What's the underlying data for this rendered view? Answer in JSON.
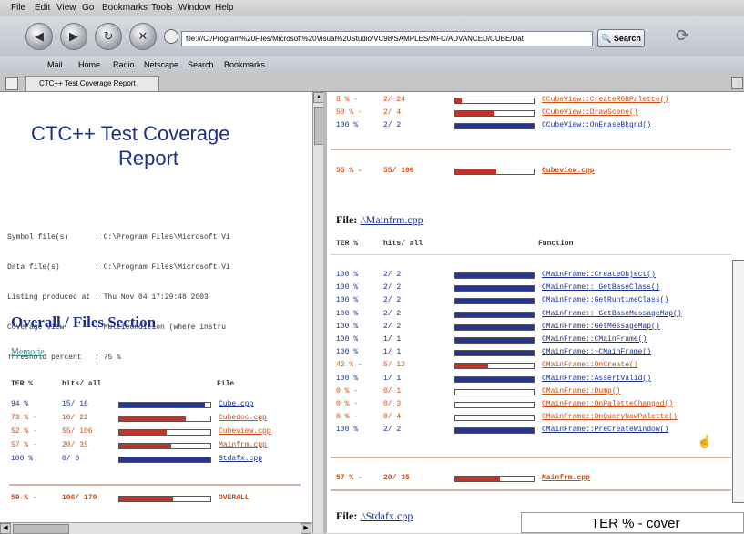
{
  "menu": [
    "File",
    "Edit",
    "View",
    "Go",
    "Bookmarks",
    "Tools",
    "Window",
    "Help"
  ],
  "url": "file:///C:/Program%20Files/Microsoft%20Visual%20Studio/VC98/SAMPLES/MFC/ADVANCED/CUBE/Dat",
  "search_label": "Search",
  "bookmarks": [
    "Mail",
    "Home",
    "Radio",
    "Netscape",
    "Search",
    "Bookmarks"
  ],
  "tab_title": "CTC++ Test Coverage Report",
  "left": {
    "title_line1": "CTC++ Test Coverage",
    "title_line2": "Report",
    "info": [
      {
        "key": "Symbol file(s)     ",
        "val": ": C:\\Program Files\\Microsoft Vi"
      },
      {
        "key": "Data file(s)       ",
        "val": ": C:\\Program Files\\Microsoft Vi"
      },
      {
        "key": "Listing produced at",
        "val": ": Thu Nov 04 17:29:48 2003"
      },
      {
        "key": "Coverage view      ",
        "val": ": Multicondition (where instru"
      },
      {
        "key": "Threshold percent  ",
        "val": ": 75 %"
      }
    ],
    "section_title": "Overall / Files Section",
    "memorie_link": "Memorie",
    "col_ter": "TER %",
    "col_hits": "hits/ all",
    "col_file": "File",
    "files": [
      {
        "ter": "94 %",
        "hits": "15/ 16",
        "file": "Cube.cpp",
        "pct": 94,
        "below": false
      },
      {
        "ter": "73 % -",
        "hits": "16/ 22",
        "file": "Cubedoc.cpp",
        "pct": 73,
        "below": true
      },
      {
        "ter": "52 % -",
        "hits": "55/ 106",
        "file": "Cubeview.cpp",
        "pct": 52,
        "below": true
      },
      {
        "ter": "57 % -",
        "hits": "20/ 35",
        "file": "Mainfrm.cpp",
        "pct": 57,
        "below": true
      },
      {
        "ter": "100 %",
        "hits": "0/ 0",
        "file": "Stdafx.cpp",
        "pct": 100,
        "below": false
      }
    ],
    "overall": {
      "ter": "59 % -",
      "hits": "106/ 179",
      "label": "OVERALL",
      "pct": 59
    }
  },
  "right": {
    "top_rows": [
      {
        "ter": "8 % -",
        "hits": "2/ 24",
        "fn": "CCubeView::CreateRGBPalette()",
        "pct": 8,
        "below": true
      },
      {
        "ter": "50 % -",
        "hits": "2/ 4",
        "fn": "CCubeView::DrawScene()",
        "pct": 50,
        "below": true
      },
      {
        "ter": "100 %",
        "hits": "2/ 2",
        "fn": "CCubeView::OnEraseBkgnd()",
        "pct": 100,
        "below": false
      }
    ],
    "cubeview_sum": {
      "ter": "55 % -",
      "hits": "55/ 106",
      "file": "Cubeview.cpp",
      "pct": 52
    },
    "file_heading_prefix": "File:",
    "file_heading_link": ".\\Mainfrm.cpp",
    "col_ter": "TER %",
    "col_hits": "hits/ all",
    "col_fn": "Function",
    "rows": [
      {
        "ter": "100 %",
        "hits": "2/ 2",
        "fn": "CMainFrame::CreateObject()",
        "pct": 100,
        "below": false
      },
      {
        "ter": "100 %",
        "hits": "2/ 2",
        "fn": "CMainFrame:: GetBaseClass()",
        "pct": 100,
        "below": false
      },
      {
        "ter": "100 %",
        "hits": "2/ 2",
        "fn": "CMainFrame::GetRuntimeClass()",
        "pct": 100,
        "below": false
      },
      {
        "ter": "100 %",
        "hits": "2/ 2",
        "fn": "CMainFrame:: GetBaseMessageMap()",
        "pct": 100,
        "below": false
      },
      {
        "ter": "100 %",
        "hits": "2/ 2",
        "fn": "CMainFrame::GetMessageMap()",
        "pct": 100,
        "below": false
      },
      {
        "ter": "100 %",
        "hits": "1/ 1",
        "fn": "CMainFrame::CMainFrame()",
        "pct": 100,
        "below": false
      },
      {
        "ter": "100 %",
        "hits": "1/ 1",
        "fn": "CMainFrame::~CMainFrame()",
        "pct": 100,
        "below": false
      },
      {
        "ter": "42 % -",
        "hits": "5/ 12",
        "fn": "CMainFrame::OnCreate()",
        "pct": 42,
        "below": true
      },
      {
        "ter": "100 %",
        "hits": "1/ 1",
        "fn": "CMainFrame::AssertValid()",
        "pct": 100,
        "below": false
      },
      {
        "ter": "0 % -",
        "hits": "0/ 1",
        "fn": "CMainFrame::Dump()",
        "pct": 0,
        "below": true
      },
      {
        "ter": "0 % -",
        "hits": "0/ 3",
        "fn": "CMainFrame::OnPaletteChanged()",
        "pct": 0,
        "below": true
      },
      {
        "ter": "0 % -",
        "hits": "0/ 4",
        "fn": "CMainFrame::OnQueryNewPalette()",
        "pct": 0,
        "below": true
      },
      {
        "ter": "100 %",
        "hits": "2/ 2",
        "fn": "CMainFrame::PreCreateWindow()",
        "pct": 100,
        "below": false
      }
    ],
    "mainfrm_sum": {
      "ter": "57 % -",
      "hits": "20/ 35",
      "file": "Mainfrm.cpp",
      "pct": 57
    },
    "next_file_prefix": "File:",
    "next_file_link": ".\\Stdafx.cpp"
  },
  "caption": "TER % - cover",
  "colors": {
    "below": "#c84b14",
    "ok": "#1a2f8a",
    "bar_below": "#c0342a",
    "bar_ok": "#27358f"
  }
}
